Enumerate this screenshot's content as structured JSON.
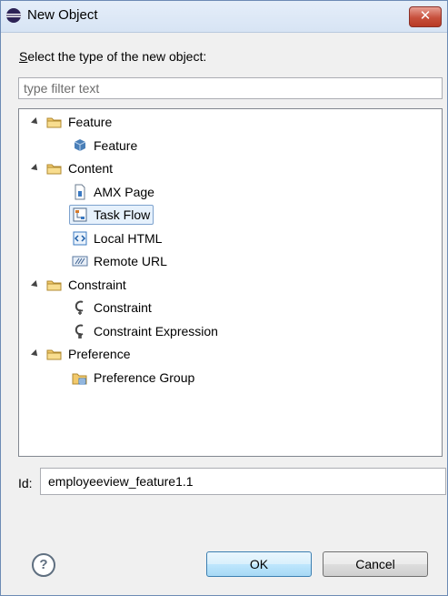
{
  "window": {
    "title": "New Object",
    "close_label": "✕"
  },
  "prompt": {
    "text_rest": "elect the type of the new object:",
    "mnemonic": "S"
  },
  "filter": {
    "placeholder": "type filter text",
    "value": ""
  },
  "tree": [
    {
      "label": "Feature",
      "icon": "folder-icon",
      "expanded": true,
      "children": [
        {
          "label": "Feature",
          "icon": "feature-icon"
        }
      ]
    },
    {
      "label": "Content",
      "icon": "folder-icon",
      "expanded": true,
      "children": [
        {
          "label": "AMX Page",
          "icon": "amx-page-icon"
        },
        {
          "label": "Task Flow",
          "icon": "task-flow-icon",
          "selected": true
        },
        {
          "label": "Local HTML",
          "icon": "local-html-icon"
        },
        {
          "label": "Remote URL",
          "icon": "remote-url-icon"
        }
      ]
    },
    {
      "label": "Constraint",
      "icon": "folder-icon",
      "expanded": true,
      "children": [
        {
          "label": "Constraint",
          "icon": "constraint-icon"
        },
        {
          "label": "Constraint Expression",
          "icon": "constraint-expression-icon"
        }
      ]
    },
    {
      "label": "Preference",
      "icon": "folder-icon",
      "expanded": true,
      "children": [
        {
          "label": "Preference Group",
          "icon": "preference-group-icon"
        }
      ]
    }
  ],
  "id_field": {
    "label": "Id:",
    "value": "employeeview_feature1.1"
  },
  "buttons": {
    "help": "?",
    "ok": "OK",
    "cancel": "Cancel"
  },
  "colors": {
    "folder": "#f2c96b",
    "selection_bg": "#e6f1fc",
    "selection_border": "#7da2ce",
    "close": "#c7503c"
  }
}
